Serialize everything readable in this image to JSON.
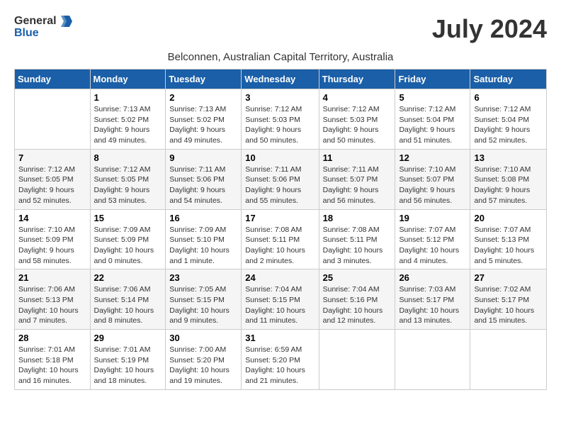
{
  "logo": {
    "text_general": "General",
    "text_blue": "Blue"
  },
  "title": {
    "month_year": "July 2024",
    "location": "Belconnen, Australian Capital Territory, Australia"
  },
  "weekdays": [
    "Sunday",
    "Monday",
    "Tuesday",
    "Wednesday",
    "Thursday",
    "Friday",
    "Saturday"
  ],
  "weeks": [
    [
      {
        "day": "",
        "sunrise": "",
        "sunset": "",
        "daylight": ""
      },
      {
        "day": "1",
        "sunrise": "Sunrise: 7:13 AM",
        "sunset": "Sunset: 5:02 PM",
        "daylight": "Daylight: 9 hours and 49 minutes."
      },
      {
        "day": "2",
        "sunrise": "Sunrise: 7:13 AM",
        "sunset": "Sunset: 5:02 PM",
        "daylight": "Daylight: 9 hours and 49 minutes."
      },
      {
        "day": "3",
        "sunrise": "Sunrise: 7:12 AM",
        "sunset": "Sunset: 5:03 PM",
        "daylight": "Daylight: 9 hours and 50 minutes."
      },
      {
        "day": "4",
        "sunrise": "Sunrise: 7:12 AM",
        "sunset": "Sunset: 5:03 PM",
        "daylight": "Daylight: 9 hours and 50 minutes."
      },
      {
        "day": "5",
        "sunrise": "Sunrise: 7:12 AM",
        "sunset": "Sunset: 5:04 PM",
        "daylight": "Daylight: 9 hours and 51 minutes."
      },
      {
        "day": "6",
        "sunrise": "Sunrise: 7:12 AM",
        "sunset": "Sunset: 5:04 PM",
        "daylight": "Daylight: 9 hours and 52 minutes."
      }
    ],
    [
      {
        "day": "7",
        "sunrise": "Sunrise: 7:12 AM",
        "sunset": "Sunset: 5:05 PM",
        "daylight": "Daylight: 9 hours and 52 minutes."
      },
      {
        "day": "8",
        "sunrise": "Sunrise: 7:12 AM",
        "sunset": "Sunset: 5:05 PM",
        "daylight": "Daylight: 9 hours and 53 minutes."
      },
      {
        "day": "9",
        "sunrise": "Sunrise: 7:11 AM",
        "sunset": "Sunset: 5:06 PM",
        "daylight": "Daylight: 9 hours and 54 minutes."
      },
      {
        "day": "10",
        "sunrise": "Sunrise: 7:11 AM",
        "sunset": "Sunset: 5:06 PM",
        "daylight": "Daylight: 9 hours and 55 minutes."
      },
      {
        "day": "11",
        "sunrise": "Sunrise: 7:11 AM",
        "sunset": "Sunset: 5:07 PM",
        "daylight": "Daylight: 9 hours and 56 minutes."
      },
      {
        "day": "12",
        "sunrise": "Sunrise: 7:10 AM",
        "sunset": "Sunset: 5:07 PM",
        "daylight": "Daylight: 9 hours and 56 minutes."
      },
      {
        "day": "13",
        "sunrise": "Sunrise: 7:10 AM",
        "sunset": "Sunset: 5:08 PM",
        "daylight": "Daylight: 9 hours and 57 minutes."
      }
    ],
    [
      {
        "day": "14",
        "sunrise": "Sunrise: 7:10 AM",
        "sunset": "Sunset: 5:09 PM",
        "daylight": "Daylight: 9 hours and 58 minutes."
      },
      {
        "day": "15",
        "sunrise": "Sunrise: 7:09 AM",
        "sunset": "Sunset: 5:09 PM",
        "daylight": "Daylight: 10 hours and 0 minutes."
      },
      {
        "day": "16",
        "sunrise": "Sunrise: 7:09 AM",
        "sunset": "Sunset: 5:10 PM",
        "daylight": "Daylight: 10 hours and 1 minute."
      },
      {
        "day": "17",
        "sunrise": "Sunrise: 7:08 AM",
        "sunset": "Sunset: 5:11 PM",
        "daylight": "Daylight: 10 hours and 2 minutes."
      },
      {
        "day": "18",
        "sunrise": "Sunrise: 7:08 AM",
        "sunset": "Sunset: 5:11 PM",
        "daylight": "Daylight: 10 hours and 3 minutes."
      },
      {
        "day": "19",
        "sunrise": "Sunrise: 7:07 AM",
        "sunset": "Sunset: 5:12 PM",
        "daylight": "Daylight: 10 hours and 4 minutes."
      },
      {
        "day": "20",
        "sunrise": "Sunrise: 7:07 AM",
        "sunset": "Sunset: 5:13 PM",
        "daylight": "Daylight: 10 hours and 5 minutes."
      }
    ],
    [
      {
        "day": "21",
        "sunrise": "Sunrise: 7:06 AM",
        "sunset": "Sunset: 5:13 PM",
        "daylight": "Daylight: 10 hours and 7 minutes."
      },
      {
        "day": "22",
        "sunrise": "Sunrise: 7:06 AM",
        "sunset": "Sunset: 5:14 PM",
        "daylight": "Daylight: 10 hours and 8 minutes."
      },
      {
        "day": "23",
        "sunrise": "Sunrise: 7:05 AM",
        "sunset": "Sunset: 5:15 PM",
        "daylight": "Daylight: 10 hours and 9 minutes."
      },
      {
        "day": "24",
        "sunrise": "Sunrise: 7:04 AM",
        "sunset": "Sunset: 5:15 PM",
        "daylight": "Daylight: 10 hours and 11 minutes."
      },
      {
        "day": "25",
        "sunrise": "Sunrise: 7:04 AM",
        "sunset": "Sunset: 5:16 PM",
        "daylight": "Daylight: 10 hours and 12 minutes."
      },
      {
        "day": "26",
        "sunrise": "Sunrise: 7:03 AM",
        "sunset": "Sunset: 5:17 PM",
        "daylight": "Daylight: 10 hours and 13 minutes."
      },
      {
        "day": "27",
        "sunrise": "Sunrise: 7:02 AM",
        "sunset": "Sunset: 5:17 PM",
        "daylight": "Daylight: 10 hours and 15 minutes."
      }
    ],
    [
      {
        "day": "28",
        "sunrise": "Sunrise: 7:01 AM",
        "sunset": "Sunset: 5:18 PM",
        "daylight": "Daylight: 10 hours and 16 minutes."
      },
      {
        "day": "29",
        "sunrise": "Sunrise: 7:01 AM",
        "sunset": "Sunset: 5:19 PM",
        "daylight": "Daylight: 10 hours and 18 minutes."
      },
      {
        "day": "30",
        "sunrise": "Sunrise: 7:00 AM",
        "sunset": "Sunset: 5:20 PM",
        "daylight": "Daylight: 10 hours and 19 minutes."
      },
      {
        "day": "31",
        "sunrise": "Sunrise: 6:59 AM",
        "sunset": "Sunset: 5:20 PM",
        "daylight": "Daylight: 10 hours and 21 minutes."
      },
      {
        "day": "",
        "sunrise": "",
        "sunset": "",
        "daylight": ""
      },
      {
        "day": "",
        "sunrise": "",
        "sunset": "",
        "daylight": ""
      },
      {
        "day": "",
        "sunrise": "",
        "sunset": "",
        "daylight": ""
      }
    ]
  ]
}
